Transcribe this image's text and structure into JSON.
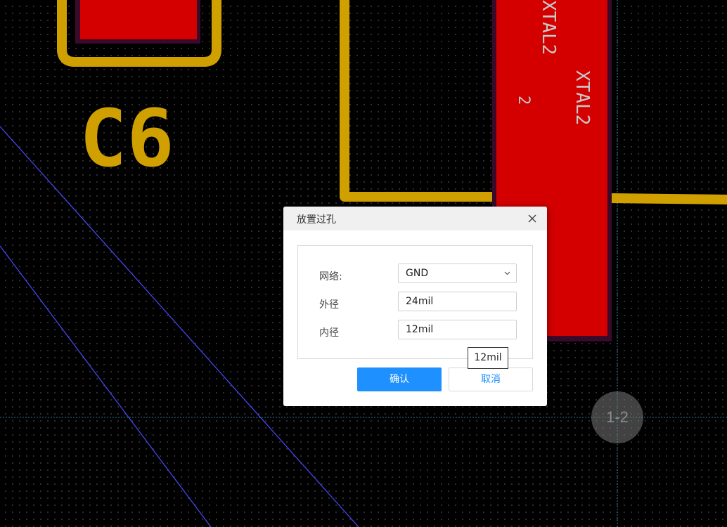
{
  "pcb": {
    "silkscreen_ref": "C6",
    "pad_label_net": "XTAL2",
    "pad_label_number": "2",
    "pad_label_top": "XTAL2",
    "colors": {
      "background": "#000000",
      "pad": "#d40000",
      "trace": "#d0a000",
      "ratsnest": "#4b4bff"
    }
  },
  "dialog": {
    "title": "放置过孔",
    "close_icon": "close-icon",
    "fields": {
      "net_label": "网络:",
      "net_value": "GND",
      "outer_label": "外径",
      "outer_value": "24mil",
      "inner_label": "内径",
      "inner_value": "12mil"
    },
    "confirm_label": "确认",
    "cancel_label": "取消",
    "accent_color": "#1e90ff"
  },
  "tooltip": {
    "text": "12mil"
  },
  "cursor_badge": {
    "text": "1-2"
  }
}
